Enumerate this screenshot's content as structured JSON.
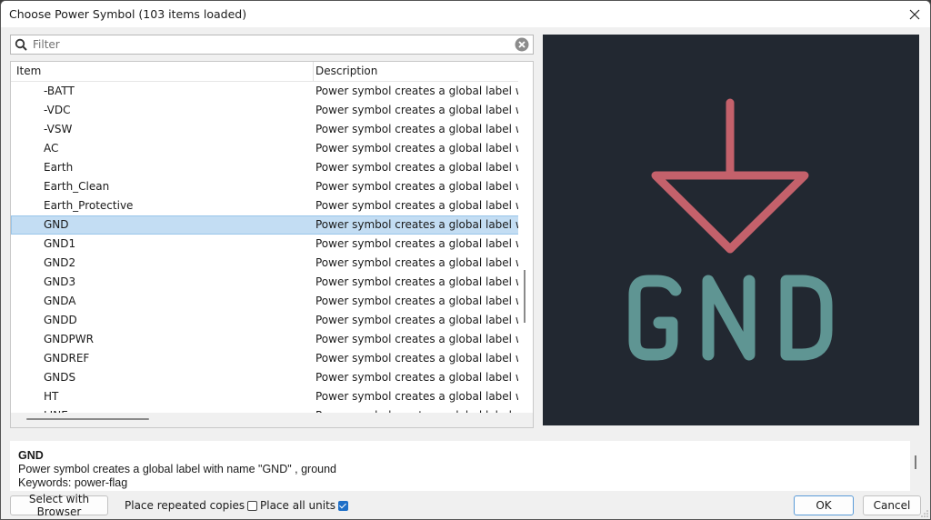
{
  "window": {
    "title": "Choose Power Symbol (103 items loaded)"
  },
  "filter": {
    "placeholder": "Filter",
    "value": ""
  },
  "list": {
    "columns": [
      "Item",
      "Description"
    ],
    "selected": "GND",
    "rows": [
      {
        "item": "-BATT",
        "description": "Power symbol creates a global label with n"
      },
      {
        "item": "-VDC",
        "description": "Power symbol creates a global label with n"
      },
      {
        "item": "-VSW",
        "description": "Power symbol creates a global label with n"
      },
      {
        "item": "AC",
        "description": "Power symbol creates a global label with n"
      },
      {
        "item": "Earth",
        "description": "Power symbol creates a global label with n"
      },
      {
        "item": "Earth_Clean",
        "description": "Power symbol creates a global label with n"
      },
      {
        "item": "Earth_Protective",
        "description": "Power symbol creates a global label with n"
      },
      {
        "item": "GND",
        "description": "Power symbol creates a global label with n"
      },
      {
        "item": "GND1",
        "description": "Power symbol creates a global label with n"
      },
      {
        "item": "GND2",
        "description": "Power symbol creates a global label with n"
      },
      {
        "item": "GND3",
        "description": "Power symbol creates a global label with n"
      },
      {
        "item": "GNDA",
        "description": "Power symbol creates a global label with n"
      },
      {
        "item": "GNDD",
        "description": "Power symbol creates a global label with n"
      },
      {
        "item": "GNDPWR",
        "description": "Power symbol creates a global label with n"
      },
      {
        "item": "GNDREF",
        "description": "Power symbol creates a global label with n"
      },
      {
        "item": "GNDS",
        "description": "Power symbol creates a global label with n"
      },
      {
        "item": "HT",
        "description": "Power symbol creates a global label with n"
      },
      {
        "item": "LINE",
        "description": "Power symbol creates a global label with n"
      }
    ]
  },
  "preview": {
    "symbol_label": "GND",
    "symbol_color": "#c4616b",
    "label_color": "#5f9593",
    "background": "#222831"
  },
  "details": {
    "name": "GND",
    "description": "Power symbol creates a global label with name \"GND\" , ground",
    "keywords": "Keywords: power-flag"
  },
  "footer": {
    "select_with_browser": "Select with Browser",
    "place_repeated_copies": "Place repeated copies",
    "place_repeated_copies_checked": false,
    "place_all_units": "Place all units",
    "place_all_units_checked": true,
    "ok": "OK",
    "cancel": "Cancel"
  }
}
